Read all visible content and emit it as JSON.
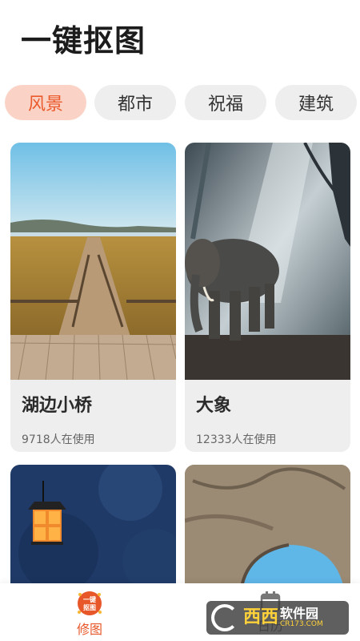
{
  "app": {
    "title": "一键抠图"
  },
  "tabs": [
    {
      "label": "风景",
      "active": true
    },
    {
      "label": "都市",
      "active": false
    },
    {
      "label": "祝福",
      "active": false
    },
    {
      "label": "建筑",
      "active": false
    }
  ],
  "templates": [
    {
      "name": "湖边小桥",
      "usage": "9718人在使用"
    },
    {
      "name": "大象",
      "usage": "12333人在使用"
    },
    {
      "name": "",
      "usage": ""
    },
    {
      "name": "",
      "usage": ""
    }
  ],
  "bottom_nav": {
    "edit_label": "修图",
    "edit_icon_text": "一键抠图",
    "calendar_label": "日历"
  },
  "watermark": {
    "brand": "西西",
    "sub": "软件园",
    "domain": "CR173.COM"
  },
  "colors": {
    "accent": "#ea5a2c",
    "tab_active_bg": "#fbd3c6",
    "tab_bg": "#eeeeee",
    "card_bg": "#eeeeee"
  }
}
